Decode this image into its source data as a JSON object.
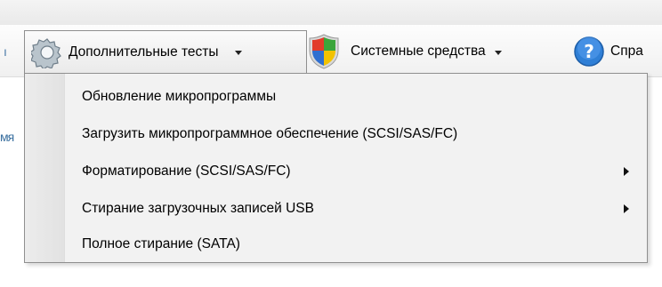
{
  "toolbar": {
    "advanced_tests": {
      "label": "Дополнительные тесты",
      "icon": "gear-icon"
    },
    "system_tools": {
      "label": "Системные средства",
      "icon": "shield-icon"
    },
    "help": {
      "label": "Спра",
      "icon": "help-icon"
    }
  },
  "side_fragments": {
    "top": "ı",
    "middle": "мя"
  },
  "menu": {
    "items": [
      {
        "label": "Обновление микропрограммы",
        "has_submenu": false
      },
      {
        "label": "Загрузить микропрограммное обеспечение (SCSI/SAS/FC)",
        "has_submenu": false
      },
      {
        "label": "Форматирование (SCSI/SAS/FC)",
        "has_submenu": true
      },
      {
        "label": "Стирание загрузочных записей USB",
        "has_submenu": true
      },
      {
        "label": "Полное стирание (SATA)",
        "has_submenu": false
      }
    ]
  },
  "colors": {
    "menu_bg": "#f2f2f2",
    "menu_border": "#8f8f8f",
    "help_icon_blue": "#2f7fd6",
    "shield_red": "#e23b2a",
    "shield_green": "#3aa53a",
    "shield_blue": "#2f6fd0",
    "shield_yellow": "#f2c200"
  }
}
